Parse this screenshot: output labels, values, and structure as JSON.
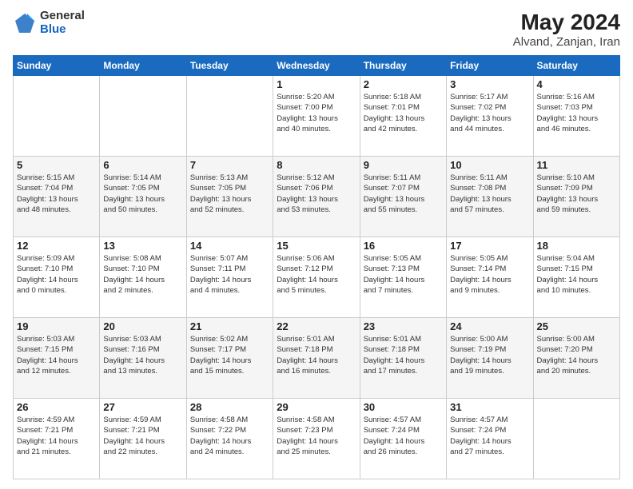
{
  "logo": {
    "general": "General",
    "blue": "Blue"
  },
  "title": "May 2024",
  "subtitle": "Alvand, Zanjan, Iran",
  "weekdays": [
    "Sunday",
    "Monday",
    "Tuesday",
    "Wednesday",
    "Thursday",
    "Friday",
    "Saturday"
  ],
  "weeks": [
    [
      {
        "day": "",
        "info": ""
      },
      {
        "day": "",
        "info": ""
      },
      {
        "day": "",
        "info": ""
      },
      {
        "day": "1",
        "info": "Sunrise: 5:20 AM\nSunset: 7:00 PM\nDaylight: 13 hours\nand 40 minutes."
      },
      {
        "day": "2",
        "info": "Sunrise: 5:18 AM\nSunset: 7:01 PM\nDaylight: 13 hours\nand 42 minutes."
      },
      {
        "day": "3",
        "info": "Sunrise: 5:17 AM\nSunset: 7:02 PM\nDaylight: 13 hours\nand 44 minutes."
      },
      {
        "day": "4",
        "info": "Sunrise: 5:16 AM\nSunset: 7:03 PM\nDaylight: 13 hours\nand 46 minutes."
      }
    ],
    [
      {
        "day": "5",
        "info": "Sunrise: 5:15 AM\nSunset: 7:04 PM\nDaylight: 13 hours\nand 48 minutes."
      },
      {
        "day": "6",
        "info": "Sunrise: 5:14 AM\nSunset: 7:05 PM\nDaylight: 13 hours\nand 50 minutes."
      },
      {
        "day": "7",
        "info": "Sunrise: 5:13 AM\nSunset: 7:05 PM\nDaylight: 13 hours\nand 52 minutes."
      },
      {
        "day": "8",
        "info": "Sunrise: 5:12 AM\nSunset: 7:06 PM\nDaylight: 13 hours\nand 53 minutes."
      },
      {
        "day": "9",
        "info": "Sunrise: 5:11 AM\nSunset: 7:07 PM\nDaylight: 13 hours\nand 55 minutes."
      },
      {
        "day": "10",
        "info": "Sunrise: 5:11 AM\nSunset: 7:08 PM\nDaylight: 13 hours\nand 57 minutes."
      },
      {
        "day": "11",
        "info": "Sunrise: 5:10 AM\nSunset: 7:09 PM\nDaylight: 13 hours\nand 59 minutes."
      }
    ],
    [
      {
        "day": "12",
        "info": "Sunrise: 5:09 AM\nSunset: 7:10 PM\nDaylight: 14 hours\nand 0 minutes."
      },
      {
        "day": "13",
        "info": "Sunrise: 5:08 AM\nSunset: 7:10 PM\nDaylight: 14 hours\nand 2 minutes."
      },
      {
        "day": "14",
        "info": "Sunrise: 5:07 AM\nSunset: 7:11 PM\nDaylight: 14 hours\nand 4 minutes."
      },
      {
        "day": "15",
        "info": "Sunrise: 5:06 AM\nSunset: 7:12 PM\nDaylight: 14 hours\nand 5 minutes."
      },
      {
        "day": "16",
        "info": "Sunrise: 5:05 AM\nSunset: 7:13 PM\nDaylight: 14 hours\nand 7 minutes."
      },
      {
        "day": "17",
        "info": "Sunrise: 5:05 AM\nSunset: 7:14 PM\nDaylight: 14 hours\nand 9 minutes."
      },
      {
        "day": "18",
        "info": "Sunrise: 5:04 AM\nSunset: 7:15 PM\nDaylight: 14 hours\nand 10 minutes."
      }
    ],
    [
      {
        "day": "19",
        "info": "Sunrise: 5:03 AM\nSunset: 7:15 PM\nDaylight: 14 hours\nand 12 minutes."
      },
      {
        "day": "20",
        "info": "Sunrise: 5:03 AM\nSunset: 7:16 PM\nDaylight: 14 hours\nand 13 minutes."
      },
      {
        "day": "21",
        "info": "Sunrise: 5:02 AM\nSunset: 7:17 PM\nDaylight: 14 hours\nand 15 minutes."
      },
      {
        "day": "22",
        "info": "Sunrise: 5:01 AM\nSunset: 7:18 PM\nDaylight: 14 hours\nand 16 minutes."
      },
      {
        "day": "23",
        "info": "Sunrise: 5:01 AM\nSunset: 7:18 PM\nDaylight: 14 hours\nand 17 minutes."
      },
      {
        "day": "24",
        "info": "Sunrise: 5:00 AM\nSunset: 7:19 PM\nDaylight: 14 hours\nand 19 minutes."
      },
      {
        "day": "25",
        "info": "Sunrise: 5:00 AM\nSunset: 7:20 PM\nDaylight: 14 hours\nand 20 minutes."
      }
    ],
    [
      {
        "day": "26",
        "info": "Sunrise: 4:59 AM\nSunset: 7:21 PM\nDaylight: 14 hours\nand 21 minutes."
      },
      {
        "day": "27",
        "info": "Sunrise: 4:59 AM\nSunset: 7:21 PM\nDaylight: 14 hours\nand 22 minutes."
      },
      {
        "day": "28",
        "info": "Sunrise: 4:58 AM\nSunset: 7:22 PM\nDaylight: 14 hours\nand 24 minutes."
      },
      {
        "day": "29",
        "info": "Sunrise: 4:58 AM\nSunset: 7:23 PM\nDaylight: 14 hours\nand 25 minutes."
      },
      {
        "day": "30",
        "info": "Sunrise: 4:57 AM\nSunset: 7:24 PM\nDaylight: 14 hours\nand 26 minutes."
      },
      {
        "day": "31",
        "info": "Sunrise: 4:57 AM\nSunset: 7:24 PM\nDaylight: 14 hours\nand 27 minutes."
      },
      {
        "day": "",
        "info": ""
      }
    ]
  ]
}
